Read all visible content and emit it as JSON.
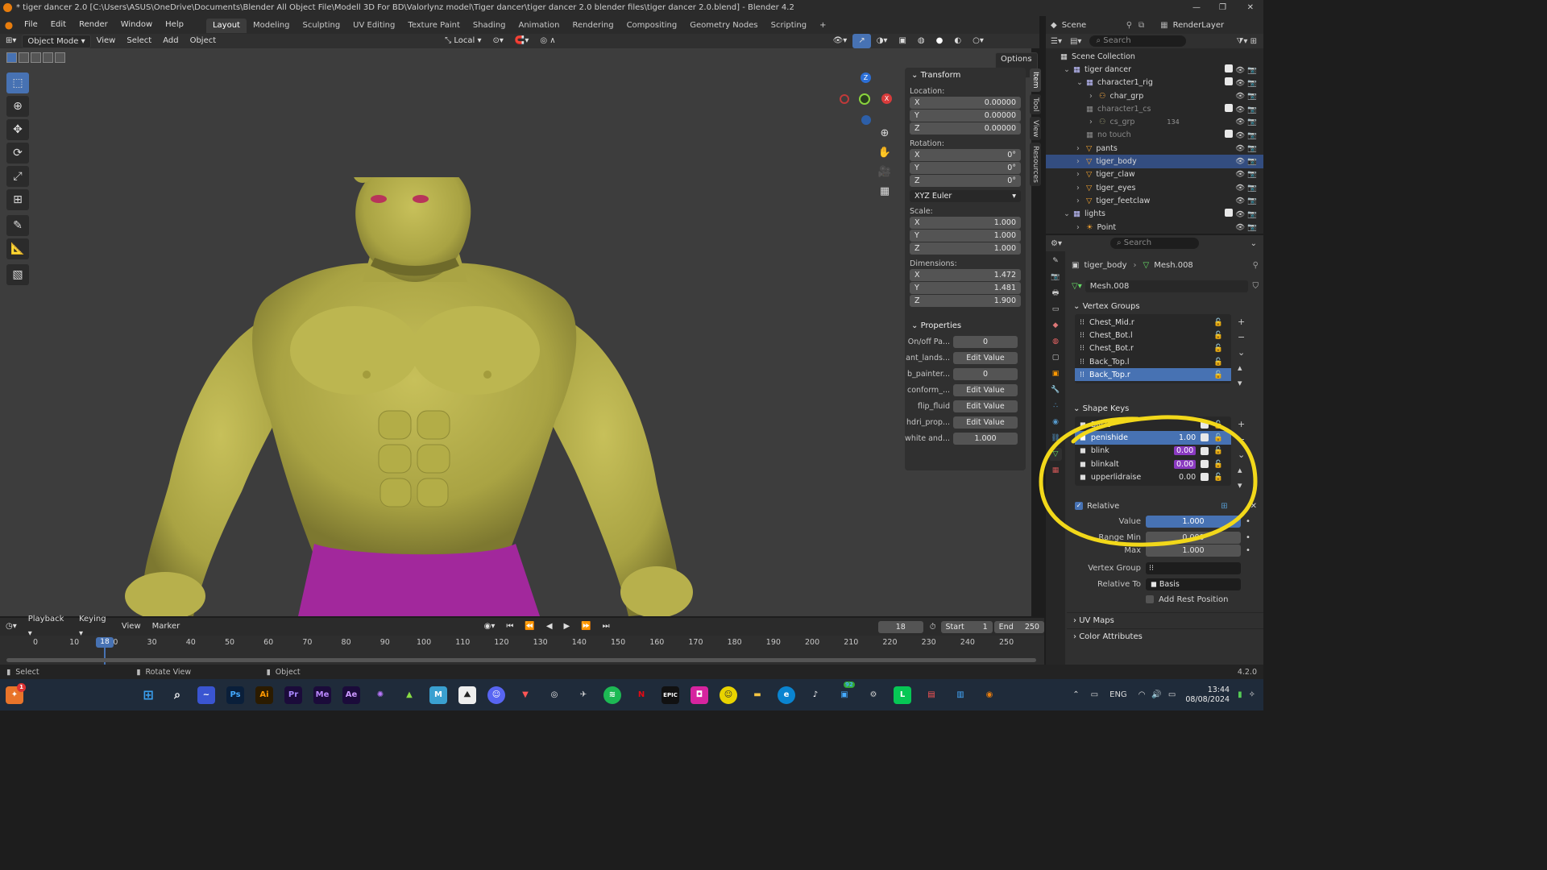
{
  "title": "* tiger dancer 2.0 [C:\\Users\\ASUS\\OneDrive\\Documents\\Blender All Object File\\Modell 3D For BD\\Valorlynz model\\Tiger dancer\\tiger dancer 2.0 blender files\\tiger dancer 2.0.blend] - Blender 4.2",
  "menus": [
    "File",
    "Edit",
    "Render",
    "Window",
    "Help"
  ],
  "workspaces": [
    "Layout",
    "Modeling",
    "Sculpting",
    "UV Editing",
    "Texture Paint",
    "Shading",
    "Animation",
    "Rendering",
    "Compositing",
    "Geometry Nodes",
    "Scripting"
  ],
  "active_workspace": "Layout",
  "scene": {
    "label": "Scene",
    "renderlayer": "RenderLayer"
  },
  "viewport_header": {
    "mode": "Object Mode",
    "items": [
      "View",
      "Select",
      "Add",
      "Object"
    ],
    "orientation": "Local",
    "options": "Options"
  },
  "transform": {
    "header": "Transform",
    "location_label": "Location:",
    "location": [
      {
        "axis": "X",
        "value": "0.00000"
      },
      {
        "axis": "Y",
        "value": "0.00000"
      },
      {
        "axis": "Z",
        "value": "0.00000"
      }
    ],
    "rotation_label": "Rotation:",
    "rotation": [
      {
        "axis": "X",
        "value": "0°"
      },
      {
        "axis": "Y",
        "value": "0°"
      },
      {
        "axis": "Z",
        "value": "0°"
      }
    ],
    "rotation_mode": "XYZ Euler",
    "scale_label": "Scale:",
    "scale": [
      {
        "axis": "X",
        "value": "1.000"
      },
      {
        "axis": "Y",
        "value": "1.000"
      },
      {
        "axis": "Z",
        "value": "1.000"
      }
    ],
    "dimensions_label": "Dimensions:",
    "dimensions": [
      {
        "axis": "X",
        "value": "1.472"
      },
      {
        "axis": "Y",
        "value": "1.481"
      },
      {
        "axis": "Z",
        "value": "1.900"
      }
    ]
  },
  "properties_panel": {
    "header": "Properties",
    "rows": [
      {
        "key": "On/off Pa...",
        "value": "0"
      },
      {
        "key": "ant_lands...",
        "value": "Edit Value"
      },
      {
        "key": "b_painter...",
        "value": "0"
      },
      {
        "key": "conform_...",
        "value": "Edit Value"
      },
      {
        "key": "flip_fluid",
        "value": "Edit Value"
      },
      {
        "key": "hdri_prop...",
        "value": "Edit Value"
      },
      {
        "key": "white and...",
        "value": "1.000"
      }
    ]
  },
  "side_tabs": [
    "Item",
    "Tool",
    "View",
    "Resources"
  ],
  "timeline": {
    "menus": [
      "Playback",
      "Keying",
      "View",
      "Marker"
    ],
    "current_frame": "18",
    "start_label": "Start",
    "start": "1",
    "end_label": "End",
    "end": "250",
    "ticks": [
      "0",
      "10",
      "20",
      "30",
      "40",
      "50",
      "60",
      "70",
      "80",
      "90",
      "100",
      "110",
      "120",
      "130",
      "140",
      "150",
      "160",
      "170",
      "180",
      "190",
      "200",
      "210",
      "220",
      "230",
      "240",
      "250"
    ],
    "playhead": "18"
  },
  "statusbar": {
    "select": "Select",
    "rotate": "Rotate View",
    "object": "Object",
    "version": "4.2.0"
  },
  "outliner": {
    "search_placeholder": "Search",
    "rows": [
      {
        "label": "Scene Collection",
        "indent": 0,
        "type": "collection-root"
      },
      {
        "label": "tiger dancer",
        "indent": 1,
        "type": "collection"
      },
      {
        "label": "character1_rig",
        "indent": 2,
        "type": "collection"
      },
      {
        "label": "char_grp",
        "indent": 3,
        "type": "armature"
      },
      {
        "label": "character1_cs",
        "indent": 2,
        "type": "collection-dim"
      },
      {
        "label": "cs_grp",
        "indent": 3,
        "type": "armature-dim",
        "badge": "134"
      },
      {
        "label": "no touch",
        "indent": 2,
        "type": "collection-dim"
      },
      {
        "label": "pants",
        "indent": 2,
        "type": "mesh"
      },
      {
        "label": "tiger_body",
        "indent": 2,
        "type": "mesh",
        "selected": true
      },
      {
        "label": "tiger_claw",
        "indent": 2,
        "type": "mesh"
      },
      {
        "label": "tiger_eyes",
        "indent": 2,
        "type": "mesh"
      },
      {
        "label": "tiger_feetclaw",
        "indent": 2,
        "type": "mesh"
      },
      {
        "label": "lights",
        "indent": 1,
        "type": "collection"
      },
      {
        "label": "Point",
        "indent": 2,
        "type": "light"
      }
    ]
  },
  "properties": {
    "search_placeholder": "Search",
    "breadcrumb_object": "tiger_body",
    "breadcrumb_mesh": "Mesh.008",
    "mesh_name": "Mesh.008",
    "vertex_groups_header": "Vertex Groups",
    "vertex_groups": [
      "Chest_Mid.r",
      "Chest_Bot.l",
      "Chest_Bot.r",
      "Back_Top.l",
      "Back_Top.r"
    ],
    "shape_keys_header": "Shape Keys",
    "shape_keys": [
      {
        "name": "Basis",
        "value": ""
      },
      {
        "name": "penishide",
        "value": "1.00",
        "selected": true
      },
      {
        "name": "blink",
        "value": "0.00",
        "pink": true
      },
      {
        "name": "blinkalt",
        "value": "0.00",
        "pink": true
      },
      {
        "name": "upperlidraise",
        "value": "0.00"
      }
    ],
    "relative_label": "Relative",
    "value_label": "Value",
    "value": "1.000",
    "range_min_label": "Range Min",
    "range_min": "0.000",
    "max_label": "Max",
    "max": "1.000",
    "vertex_group_label": "Vertex Group",
    "relative_to_label": "Relative To",
    "relative_to": "Basis",
    "add_rest_label": "Add Rest Position",
    "uv_maps": "UV Maps",
    "color_attributes": "Color Attributes"
  },
  "taskbar": {
    "time": "13:44",
    "date": "08/08/2024",
    "lang": "ENG",
    "notif_badge": "1",
    "chat_badge": "92"
  },
  "colors": {
    "accent": "#4772b3",
    "highlight_circle": "#f2d81a",
    "mesh_color": "#b3ad4a",
    "pants": "#a2289c"
  }
}
